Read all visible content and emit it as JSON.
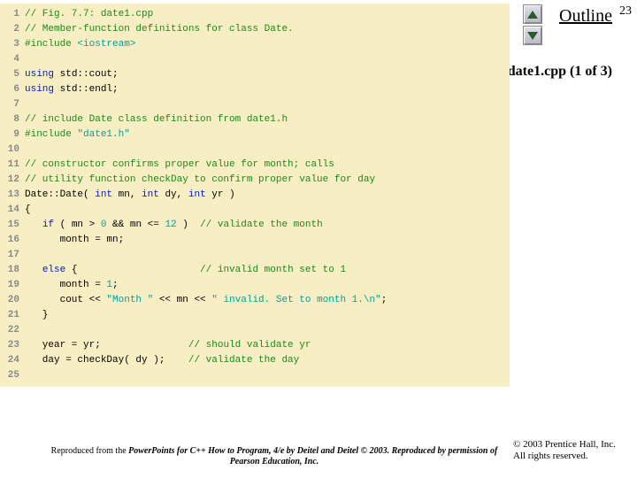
{
  "page_number": "23",
  "outline_label": "Outline",
  "subtitle": "date1.cpp (1 of 3)",
  "nav": {
    "up": "▲",
    "down": "▼"
  },
  "code": {
    "lines": [
      {
        "n": "1",
        "segs": [
          {
            "cls": "c-comment",
            "t": "// Fig. 7.7: date1.cpp"
          }
        ]
      },
      {
        "n": "2",
        "segs": [
          {
            "cls": "c-comment",
            "t": "// Member-function definitions for class Date."
          }
        ]
      },
      {
        "n": "3",
        "segs": [
          {
            "cls": "c-pp",
            "t": "#include "
          },
          {
            "cls": "c-str",
            "t": "<iostream>"
          }
        ]
      },
      {
        "n": "4",
        "segs": []
      },
      {
        "n": "5",
        "segs": [
          {
            "cls": "c-kw",
            "t": "using"
          },
          {
            "cls": "c-plain",
            "t": " std::cout;"
          }
        ]
      },
      {
        "n": "6",
        "segs": [
          {
            "cls": "c-kw",
            "t": "using"
          },
          {
            "cls": "c-plain",
            "t": " std::endl;"
          }
        ]
      },
      {
        "n": "7",
        "segs": []
      },
      {
        "n": "8",
        "segs": [
          {
            "cls": "c-comment",
            "t": "// include Date class definition from date1.h"
          }
        ]
      },
      {
        "n": "9",
        "segs": [
          {
            "cls": "c-pp",
            "t": "#include "
          },
          {
            "cls": "c-str",
            "t": "\"date1.h\""
          }
        ]
      },
      {
        "n": "10",
        "segs": []
      },
      {
        "n": "11",
        "segs": [
          {
            "cls": "c-comment",
            "t": "// constructor confirms proper value for month; calls"
          }
        ]
      },
      {
        "n": "12",
        "segs": [
          {
            "cls": "c-comment",
            "t": "// utility function checkDay to confirm proper value for day"
          }
        ]
      },
      {
        "n": "13",
        "segs": [
          {
            "cls": "c-plain",
            "t": "Date::Date( "
          },
          {
            "cls": "c-kw",
            "t": "int"
          },
          {
            "cls": "c-plain",
            "t": " mn, "
          },
          {
            "cls": "c-kw",
            "t": "int"
          },
          {
            "cls": "c-plain",
            "t": " dy, "
          },
          {
            "cls": "c-kw",
            "t": "int"
          },
          {
            "cls": "c-plain",
            "t": " yr )"
          }
        ]
      },
      {
        "n": "14",
        "segs": [
          {
            "cls": "c-plain",
            "t": "{"
          }
        ]
      },
      {
        "n": "15",
        "segs": [
          {
            "cls": "c-plain",
            "t": "   "
          },
          {
            "cls": "c-kw",
            "t": "if"
          },
          {
            "cls": "c-plain",
            "t": " ( mn > "
          },
          {
            "cls": "c-str",
            "t": "0"
          },
          {
            "cls": "c-plain",
            "t": " && mn <= "
          },
          {
            "cls": "c-str",
            "t": "12"
          },
          {
            "cls": "c-plain",
            "t": " )  "
          },
          {
            "cls": "c-comment",
            "t": "// validate the month"
          }
        ]
      },
      {
        "n": "16",
        "segs": [
          {
            "cls": "c-plain",
            "t": "      month = mn;"
          }
        ]
      },
      {
        "n": "17",
        "segs": []
      },
      {
        "n": "18",
        "segs": [
          {
            "cls": "c-plain",
            "t": "   "
          },
          {
            "cls": "c-kw",
            "t": "else"
          },
          {
            "cls": "c-plain",
            "t": " {                     "
          },
          {
            "cls": "c-comment",
            "t": "// invalid month set to 1"
          }
        ]
      },
      {
        "n": "19",
        "segs": [
          {
            "cls": "c-plain",
            "t": "      month = "
          },
          {
            "cls": "c-str",
            "t": "1"
          },
          {
            "cls": "c-plain",
            "t": ";"
          }
        ]
      },
      {
        "n": "20",
        "segs": [
          {
            "cls": "c-plain",
            "t": "      cout << "
          },
          {
            "cls": "c-str",
            "t": "\"Month \""
          },
          {
            "cls": "c-plain",
            "t": " << mn << "
          },
          {
            "cls": "c-str",
            "t": "\" invalid. Set to month 1.\\n\""
          },
          {
            "cls": "c-plain",
            "t": ";"
          }
        ]
      },
      {
        "n": "21",
        "segs": [
          {
            "cls": "c-plain",
            "t": "   }"
          }
        ]
      },
      {
        "n": "22",
        "segs": []
      },
      {
        "n": "23",
        "segs": [
          {
            "cls": "c-plain",
            "t": "   year = yr;               "
          },
          {
            "cls": "c-comment",
            "t": "// should validate yr"
          }
        ]
      },
      {
        "n": "24",
        "segs": [
          {
            "cls": "c-plain",
            "t": "   day = checkDay( dy );    "
          },
          {
            "cls": "c-comment",
            "t": "// validate the day"
          }
        ]
      },
      {
        "n": "25",
        "segs": []
      }
    ]
  },
  "copyright": {
    "line1": "© 2003 Prentice Hall, Inc.",
    "line2": "All rights reserved."
  },
  "repro": {
    "pre": "Reproduced from the ",
    "bold": "PowerPoints for C++ How to Program, 4/e by Deitel and Deitel © 2003. Reproduced by permission of Pearson Education, Inc.",
    "post": ""
  }
}
